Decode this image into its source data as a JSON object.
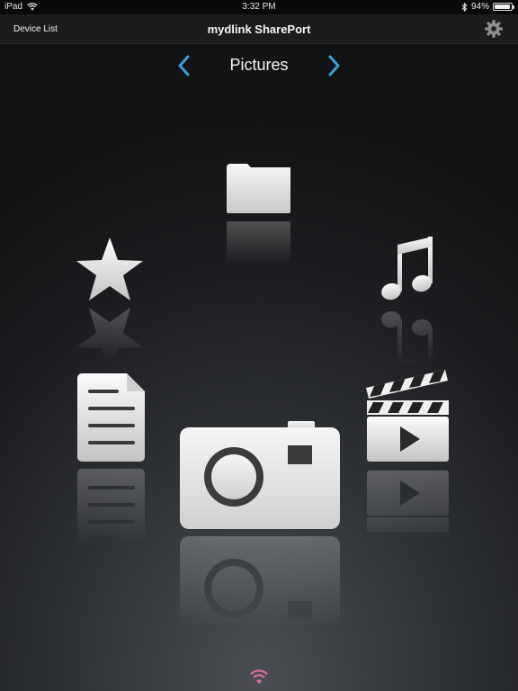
{
  "status_bar": {
    "device": "iPad",
    "time": "3:32 PM",
    "battery_text": "94%",
    "battery_level": 0.94,
    "icons": [
      "wifi-icon",
      "bluetooth-icon",
      "battery-icon"
    ]
  },
  "nav": {
    "back_label": "Device List",
    "title": "mydlink SharePort",
    "settings_icon": "gear-icon"
  },
  "category": {
    "current": "Pictures",
    "prev_icon": "chevron-left-icon",
    "next_icon": "chevron-right-icon"
  },
  "carousel": {
    "items": [
      "folder",
      "favorites",
      "music",
      "documents",
      "pictures",
      "videos"
    ],
    "selected": "pictures"
  },
  "colors": {
    "accent": "#3a9fd8",
    "icon_light": "#f4f4f4",
    "icon_dark": "#bcbcbc",
    "connection_icon": "#e36ba7"
  }
}
